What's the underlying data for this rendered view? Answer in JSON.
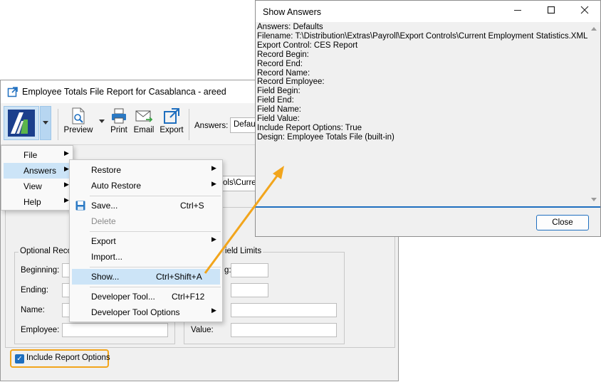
{
  "main_window": {
    "title": "Employee Totals File Report for Casablanca - areed",
    "toolbar": {
      "preview_label": "Preview",
      "print_label": "Print",
      "email_label": "Email",
      "export_label": "Export",
      "answers_label": "Answers:",
      "answers_value": "Defaul"
    },
    "path_value": "trols\\Curren",
    "optional_group_title": "Optional Reco",
    "field_limits_title": "ield Limits",
    "fields": {
      "beginning_label": "Beginning:",
      "ending_label": "Ending:",
      "name_label": "Name:",
      "employee_label": "Employee:",
      "g_label": "g:",
      "value_label": "Value:"
    },
    "include_report_options": {
      "label": "Include Report Options",
      "checked": true
    }
  },
  "app_menu": {
    "items": [
      {
        "label": "File"
      },
      {
        "label": "Answers"
      },
      {
        "label": "View"
      },
      {
        "label": "Help"
      }
    ]
  },
  "answers_submenu": {
    "restore": "Restore",
    "auto_restore": "Auto Restore",
    "save": "Save...",
    "save_shortcut": "Ctrl+S",
    "delete": "Delete",
    "export": "Export",
    "import": "Import...",
    "show": "Show...",
    "show_shortcut": "Ctrl+Shift+A",
    "developer_tool": "Developer Tool...",
    "developer_tool_shortcut": "Ctrl+F12",
    "developer_tool_options": "Developer Tool Options"
  },
  "show_answers_dialog": {
    "title": "Show Answers",
    "lines": [
      "Answers: Defaults",
      "Filename: T:\\Distribution\\Extras\\Payroll\\Export Controls\\Current Employment Statistics.XML",
      "Export Control: CES Report",
      "Record Begin:",
      "Record End:",
      "Record Name:",
      "Record Employee:",
      "Field Begin:",
      "Field End:",
      "Field Name:",
      "Field Value:",
      "Include Report Options: True",
      "Design: Employee Totals File (built-in)"
    ],
    "close_label": "Close"
  },
  "colors": {
    "highlight": "#f2a51c",
    "accent": "#1f6fbf",
    "menu_highlight": "#cce4f7"
  }
}
